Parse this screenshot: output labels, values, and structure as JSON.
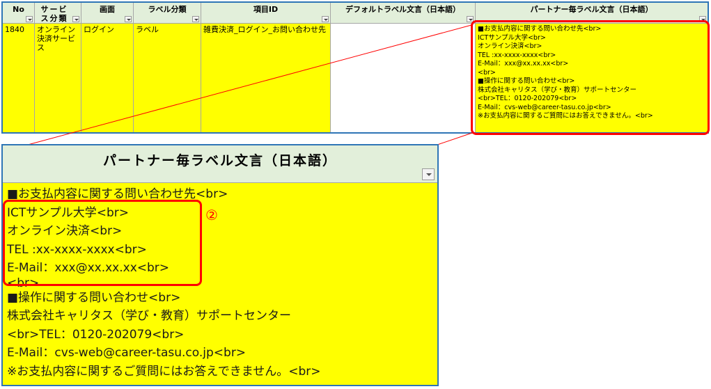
{
  "table": {
    "headers": [
      "No",
      "サービス分類",
      "画面",
      "ラベル分類",
      "項目ID",
      "デフォルトラベル文言（日本語）",
      "パートナー毎ラベル文言（日本語）"
    ],
    "row": {
      "no": "1840",
      "service": "オンライン決済サービス",
      "screen": "ログイン",
      "label_type": "ラベル",
      "item_id": "雑費決済_ログイン_お問い合わせ先",
      "default_text": "",
      "partner_lines": [
        "■お支払内容に関する問い合わせ先<br>",
        "ICTサンプル大学<br>",
        "オンライン決済<br>",
        "TEL :xx-xxxx-xxxx<br>",
        "E-Mail：xxx@xx.xx.xx<br>",
        "<br>",
        "■操作に関する問い合わせ<br>",
        "株式会社キャリタス（学び・教育）サポートセンター",
        "<br>TEL：0120-202079<br>",
        "E-Mail：cvs-web@career-tasu.co.jp<br>",
        "※お支払内容に関するご質問にはお答えできません。<br>"
      ]
    }
  },
  "zoom": {
    "header": "パートナー毎ラベル文言（日本語）",
    "marker": "②"
  },
  "colors": {
    "highlight": "#ffff00",
    "header_bg": "#e2efda",
    "annotation": "#ff0000",
    "frame": "#2e75b6"
  }
}
